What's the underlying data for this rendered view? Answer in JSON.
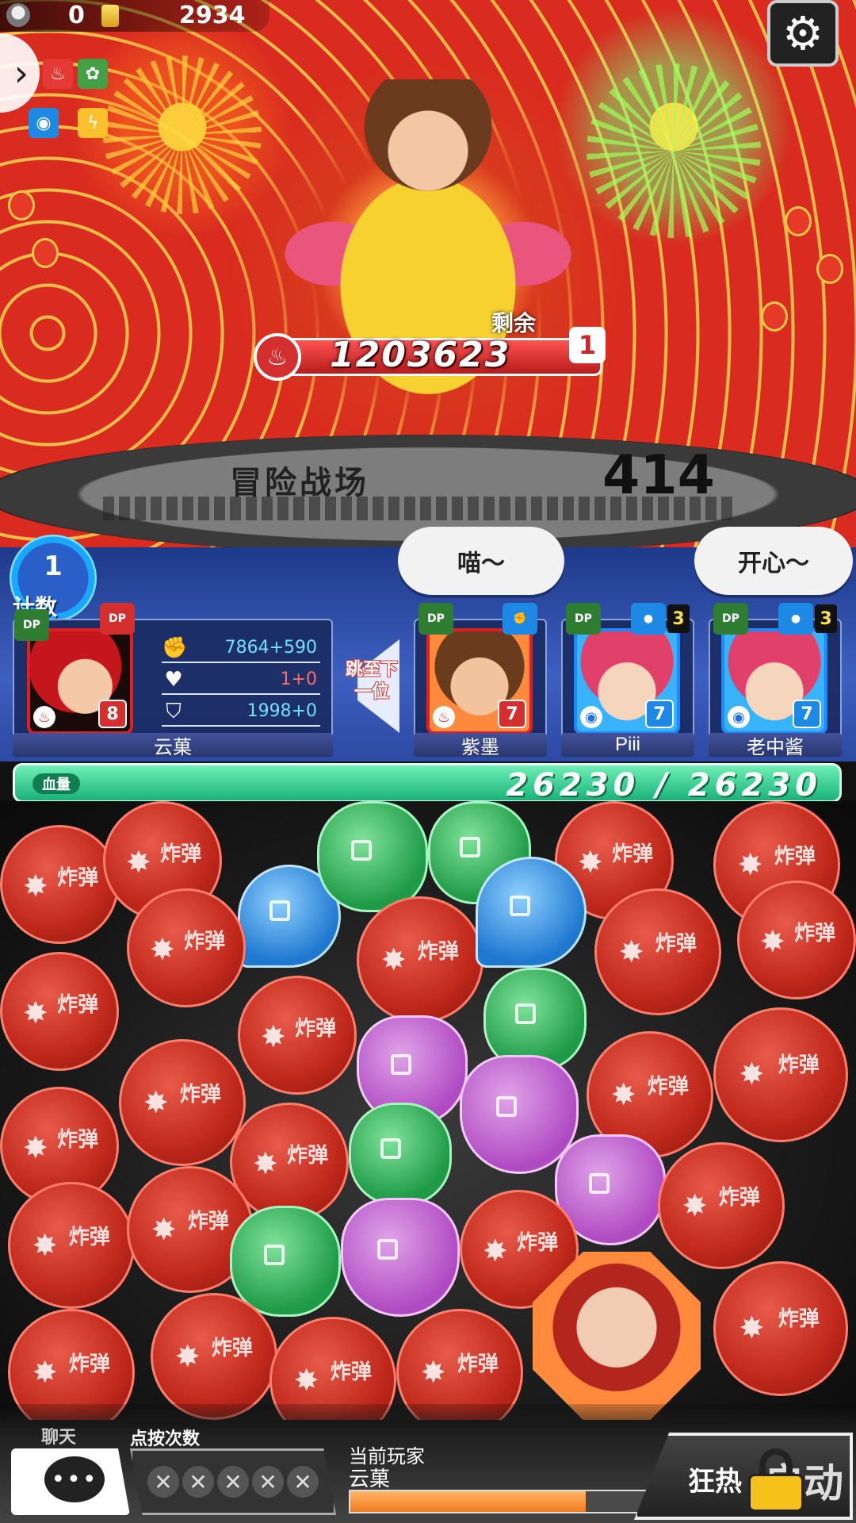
{
  "hud": {
    "count": "0",
    "gold": "2934",
    "icons": [
      "avatar-icon",
      "coin-icon",
      "gear-icon",
      "chevron-right-icon"
    ]
  },
  "side_elements": [
    "fire-icon",
    "wood-icon",
    "water-icon",
    "lightning-icon"
  ],
  "boss": {
    "hp": "1203623",
    "remaining_label": "剩余",
    "remaining": "1"
  },
  "banner": {
    "title": "冒险战场",
    "number": "414"
  },
  "turn": {
    "number": "1",
    "label": "计数"
  },
  "bubbles": [
    "喵～",
    "开心～"
  ],
  "leader": {
    "name": "云菓",
    "level": "8",
    "element": "fire",
    "tag": "DP",
    "stats": {
      "attack": "7864+590",
      "heal": "1+0",
      "defense": "1998+0"
    }
  },
  "jump_next": "跳至下一位",
  "members": [
    {
      "name": "紫墨",
      "level": "7",
      "element": "fire",
      "skill_count": ""
    },
    {
      "name": "Piii",
      "level": "7",
      "element": "water",
      "skill_count": "3"
    },
    {
      "name": "老中酱",
      "level": "7",
      "element": "water",
      "skill_count": "3"
    }
  ],
  "team_hp": {
    "label": "血量",
    "value": "26230 / 26230"
  },
  "board": {
    "bomb_label": "炸弹"
  },
  "bottom": {
    "chat_label": "聊天",
    "taps_label": "点按次数",
    "taps": [
      "✕",
      "✕",
      "✕",
      "✕",
      "✕"
    ],
    "current_player_label": "当前玩家",
    "current_player": "云菓",
    "timer_fraction": 0.75,
    "fever_label": "狂热",
    "fever_label2": "启动",
    "fever_locked": true
  },
  "colors": {
    "fire": "#d32f2f",
    "water": "#1e88e5",
    "hp": "#19b27a",
    "timer": "#f07b1d"
  }
}
